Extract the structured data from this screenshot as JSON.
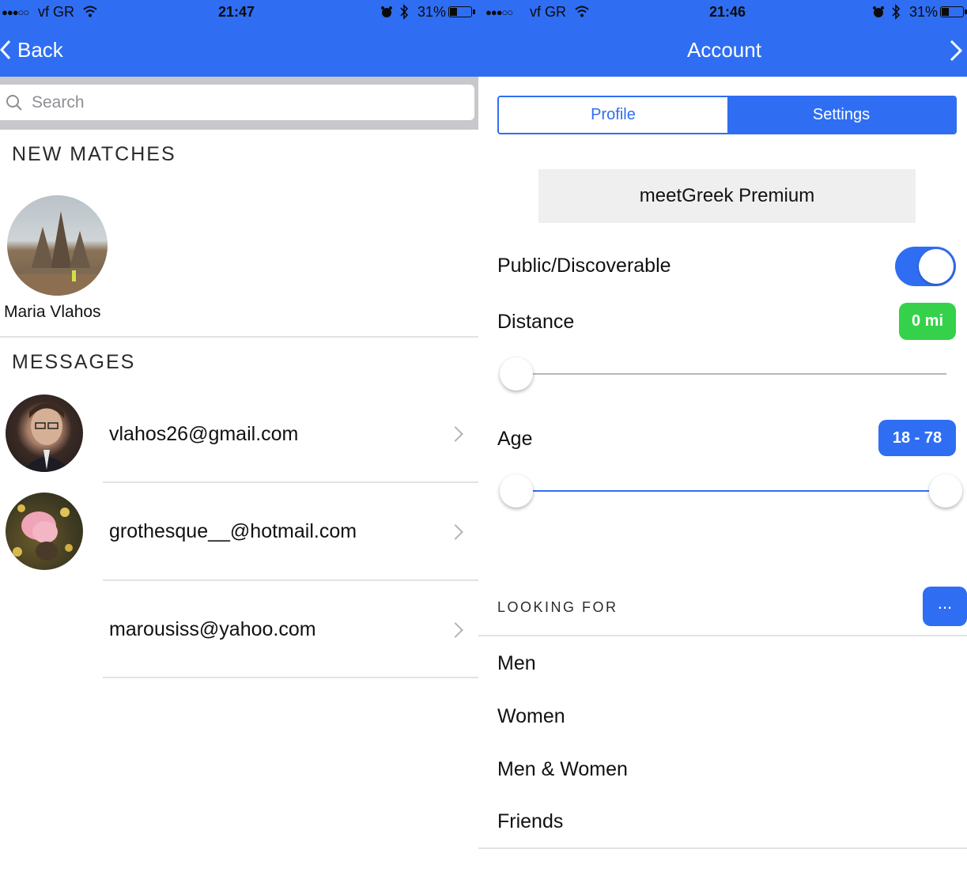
{
  "left": {
    "status": {
      "carrier": "vf GR",
      "time": "21:47",
      "battery": "31%"
    },
    "nav": {
      "back_label": "Back"
    },
    "search": {
      "placeholder": "Search"
    },
    "new_matches": {
      "title": "NEW MATCHES",
      "items": [
        {
          "name": "Maria Vlahos"
        }
      ]
    },
    "messages": {
      "title": "MESSAGES",
      "items": [
        {
          "email": "vlahos26@gmail.com"
        },
        {
          "email": "grothesque__@hotmail.com"
        },
        {
          "email": "marousiss@yahoo.com"
        }
      ]
    }
  },
  "right": {
    "status": {
      "carrier": "vf GR",
      "time": "21:46",
      "battery": "31%"
    },
    "nav": {
      "title": "Account"
    },
    "segmented": {
      "profile_label": "Profile",
      "settings_label": "Settings",
      "selected": "Settings"
    },
    "premium_label": "meetGreek Premium",
    "public": {
      "label": "Public/Discoverable",
      "on": true
    },
    "distance": {
      "label": "Distance",
      "value": "0 mi",
      "slider_fraction": 0
    },
    "age": {
      "label": "Age",
      "value": "18 - 78",
      "min_fraction": 0,
      "max_fraction": 1
    },
    "looking_for": {
      "title": "LOOKING FOR",
      "more_label": "...",
      "options": [
        "Men",
        "Women",
        "Men & Women",
        "Friends"
      ]
    }
  },
  "colors": {
    "accent": "#2f6ef2",
    "green": "#35d14a",
    "status_text": "#0b0b0b"
  }
}
